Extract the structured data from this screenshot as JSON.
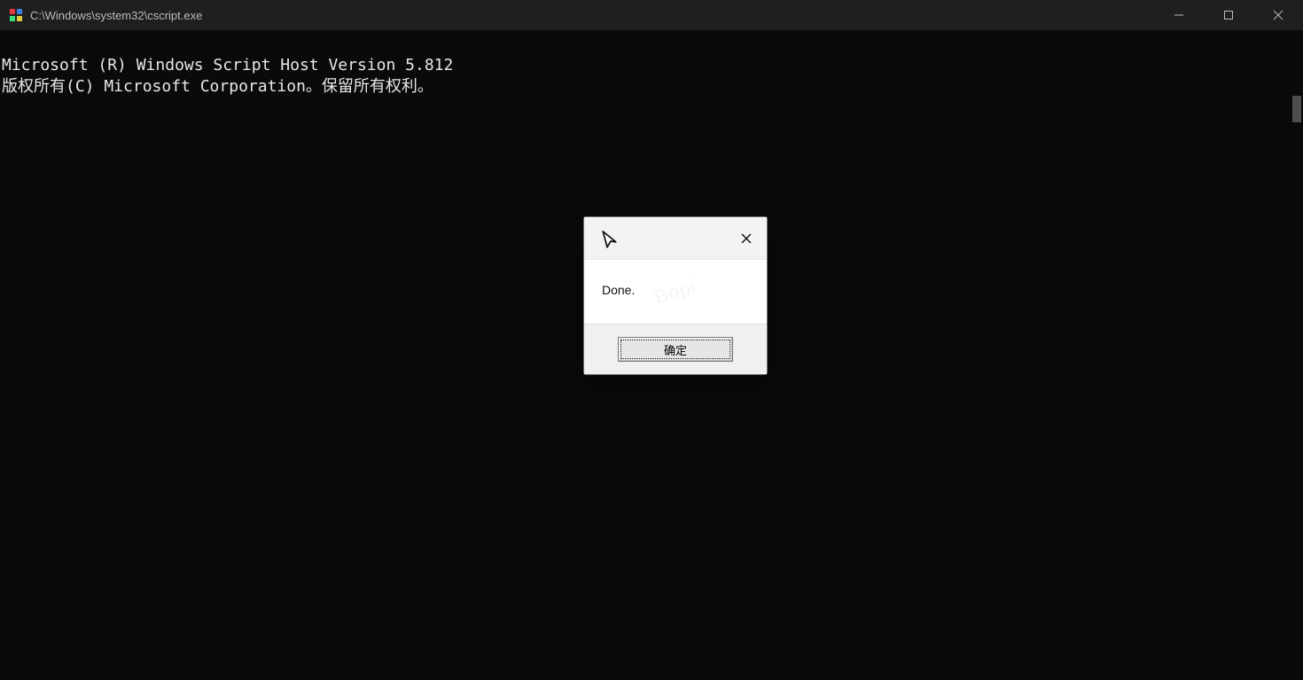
{
  "window": {
    "title": "C:\\Windows\\system32\\cscript.exe"
  },
  "console": {
    "line1": "Microsoft (R) Windows Script Host Version 5.812",
    "line2": "版权所有(C) Microsoft Corporation。保留所有权利。"
  },
  "dialog": {
    "message": "Done.",
    "ok_label": "确定"
  }
}
